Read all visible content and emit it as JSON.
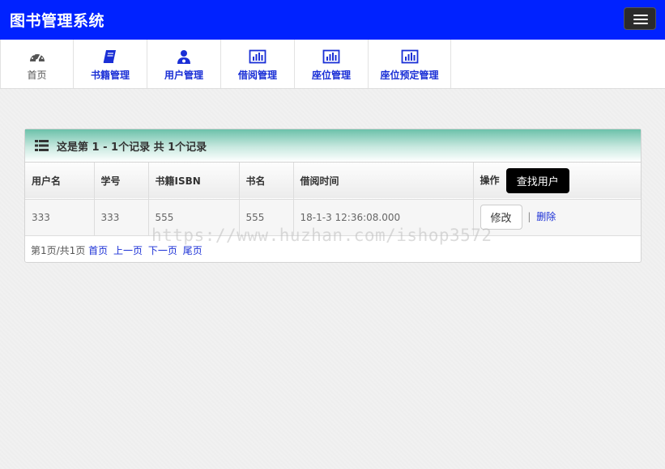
{
  "app": {
    "title": "图书管理系统"
  },
  "nav": {
    "items": [
      {
        "label": "首页",
        "icon": "dashboard-icon"
      },
      {
        "label": "书籍管理",
        "icon": "book-icon"
      },
      {
        "label": "用户管理",
        "icon": "user-icon"
      },
      {
        "label": "借阅管理",
        "icon": "bar-chart-icon"
      },
      {
        "label": "座位管理",
        "icon": "bar-chart-icon"
      },
      {
        "label": "座位预定管理",
        "icon": "bar-chart-icon"
      }
    ]
  },
  "panel": {
    "title": "这是第 1 -  1个记录 共 1个记录",
    "columns": [
      "用户名",
      "学号",
      "书籍ISBN",
      "书名",
      "借阅时间",
      "操作"
    ],
    "find_user_label": "查找用户",
    "rows": [
      {
        "username": "333",
        "student_no": "333",
        "isbn": "555",
        "book_name": "555",
        "borrow_time": "18-1-3 12:36:08.000",
        "edit_label": "修改",
        "delete_label": "删除"
      }
    ],
    "pager": {
      "status": "第1页/共1页",
      "first": "首页",
      "prev": "上一页",
      "next": "下一页",
      "last": "尾页"
    }
  },
  "watermark": "https://www.huzhan.com/ishop3572",
  "colors": {
    "topbar": "#0022ff",
    "link": "#1a2fd6",
    "panel_head": "#6cc1aa"
  }
}
